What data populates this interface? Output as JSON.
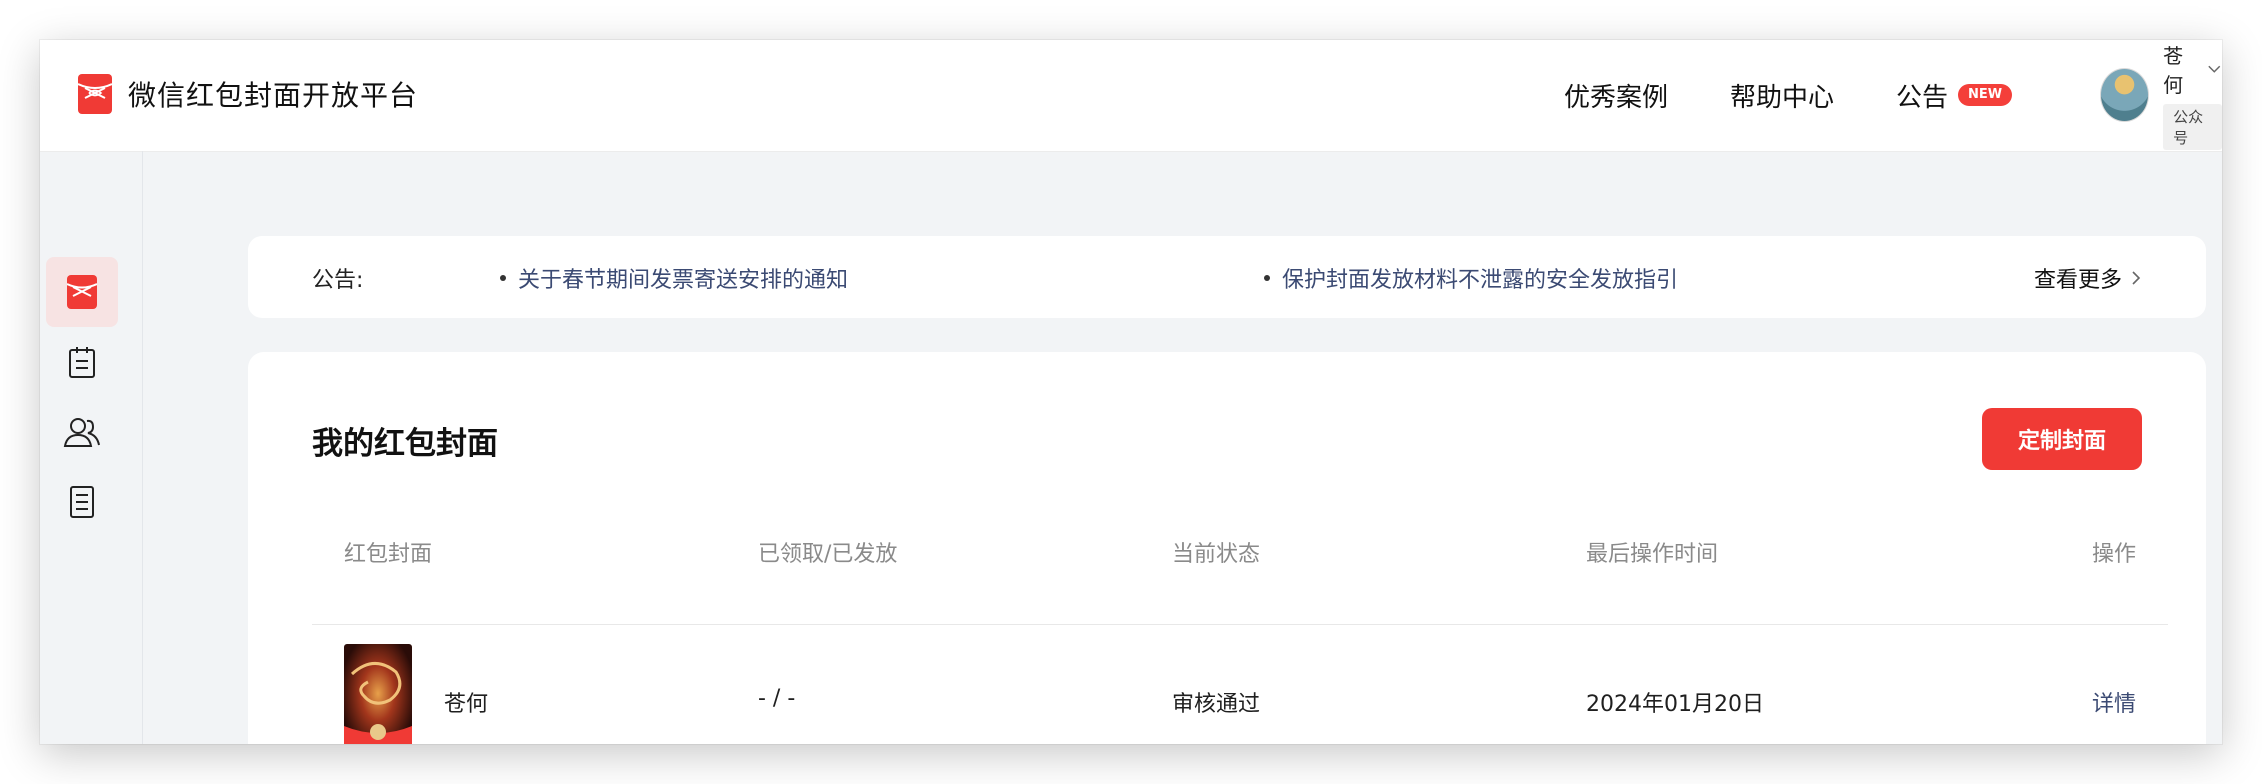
{
  "header": {
    "brand_name": "微信红包封面开放平台",
    "nav": {
      "showcase": "优秀案例",
      "help": "帮助中心",
      "announcement": "公告",
      "new_badge": "NEW"
    },
    "user": {
      "name": "苍何",
      "tag": "公众号"
    }
  },
  "sidebar": {
    "items": [
      {
        "icon": "red-envelope-icon",
        "active": true
      },
      {
        "icon": "clipboard-icon",
        "active": false
      },
      {
        "icon": "users-icon",
        "active": false
      },
      {
        "icon": "document-icon",
        "active": false
      }
    ]
  },
  "notice": {
    "label": "公告:",
    "items": [
      "关于春节期间发票寄送安排的通知",
      "保护封面发放材料不泄露的安全发放指引"
    ],
    "more": "查看更多"
  },
  "main": {
    "title": "我的红包封面",
    "create_button": "定制封面",
    "columns": [
      "红包封面",
      "已领取/已发放",
      "当前状态",
      "最后操作时间",
      "操作"
    ],
    "rows": [
      {
        "name": "苍何",
        "claimed_issued": "- / -",
        "status": "审核通过",
        "last_time": "2024年01月20日",
        "action": "详情"
      }
    ]
  },
  "colors": {
    "brand_red": "#f03a35",
    "link_blue": "#3b4a73",
    "page_bg": "#f2f4f6"
  }
}
